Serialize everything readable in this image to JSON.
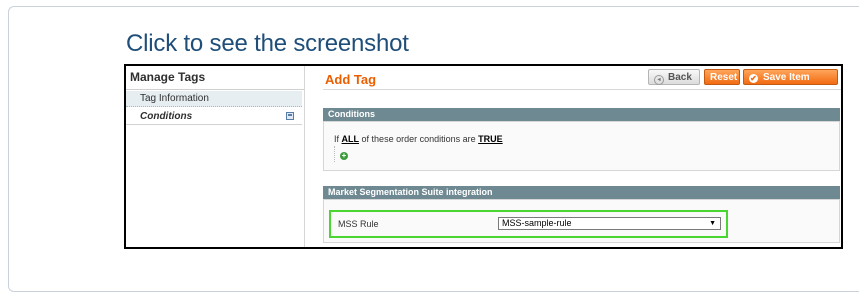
{
  "caption": "Click to see the screenshot",
  "sidebar": {
    "title": "Manage Tags",
    "items": [
      {
        "label": "Tag Information"
      },
      {
        "label": "Conditions"
      }
    ]
  },
  "main": {
    "title": "Add Tag",
    "buttons": {
      "back": "Back",
      "reset": "Reset",
      "save": "Save Item"
    },
    "conditions": {
      "header": "Conditions",
      "text_prefix": "If",
      "aggregator": "ALL",
      "text_middle": "of these order conditions are",
      "value": "TRUE"
    },
    "mss": {
      "header": "Market Segmentation Suite integration",
      "label": "MSS Rule",
      "selected": "MSS-sample-rule"
    }
  },
  "colors": {
    "accent": "#eb5e00",
    "section_header": "#6f8992",
    "highlight": "#4ad630",
    "caption": "#1f4e79"
  },
  "icons": {
    "back": "back-arrow-icon",
    "save": "check-circle-icon",
    "add": "add-condition-icon",
    "tab_save": "save-disk-icon"
  }
}
